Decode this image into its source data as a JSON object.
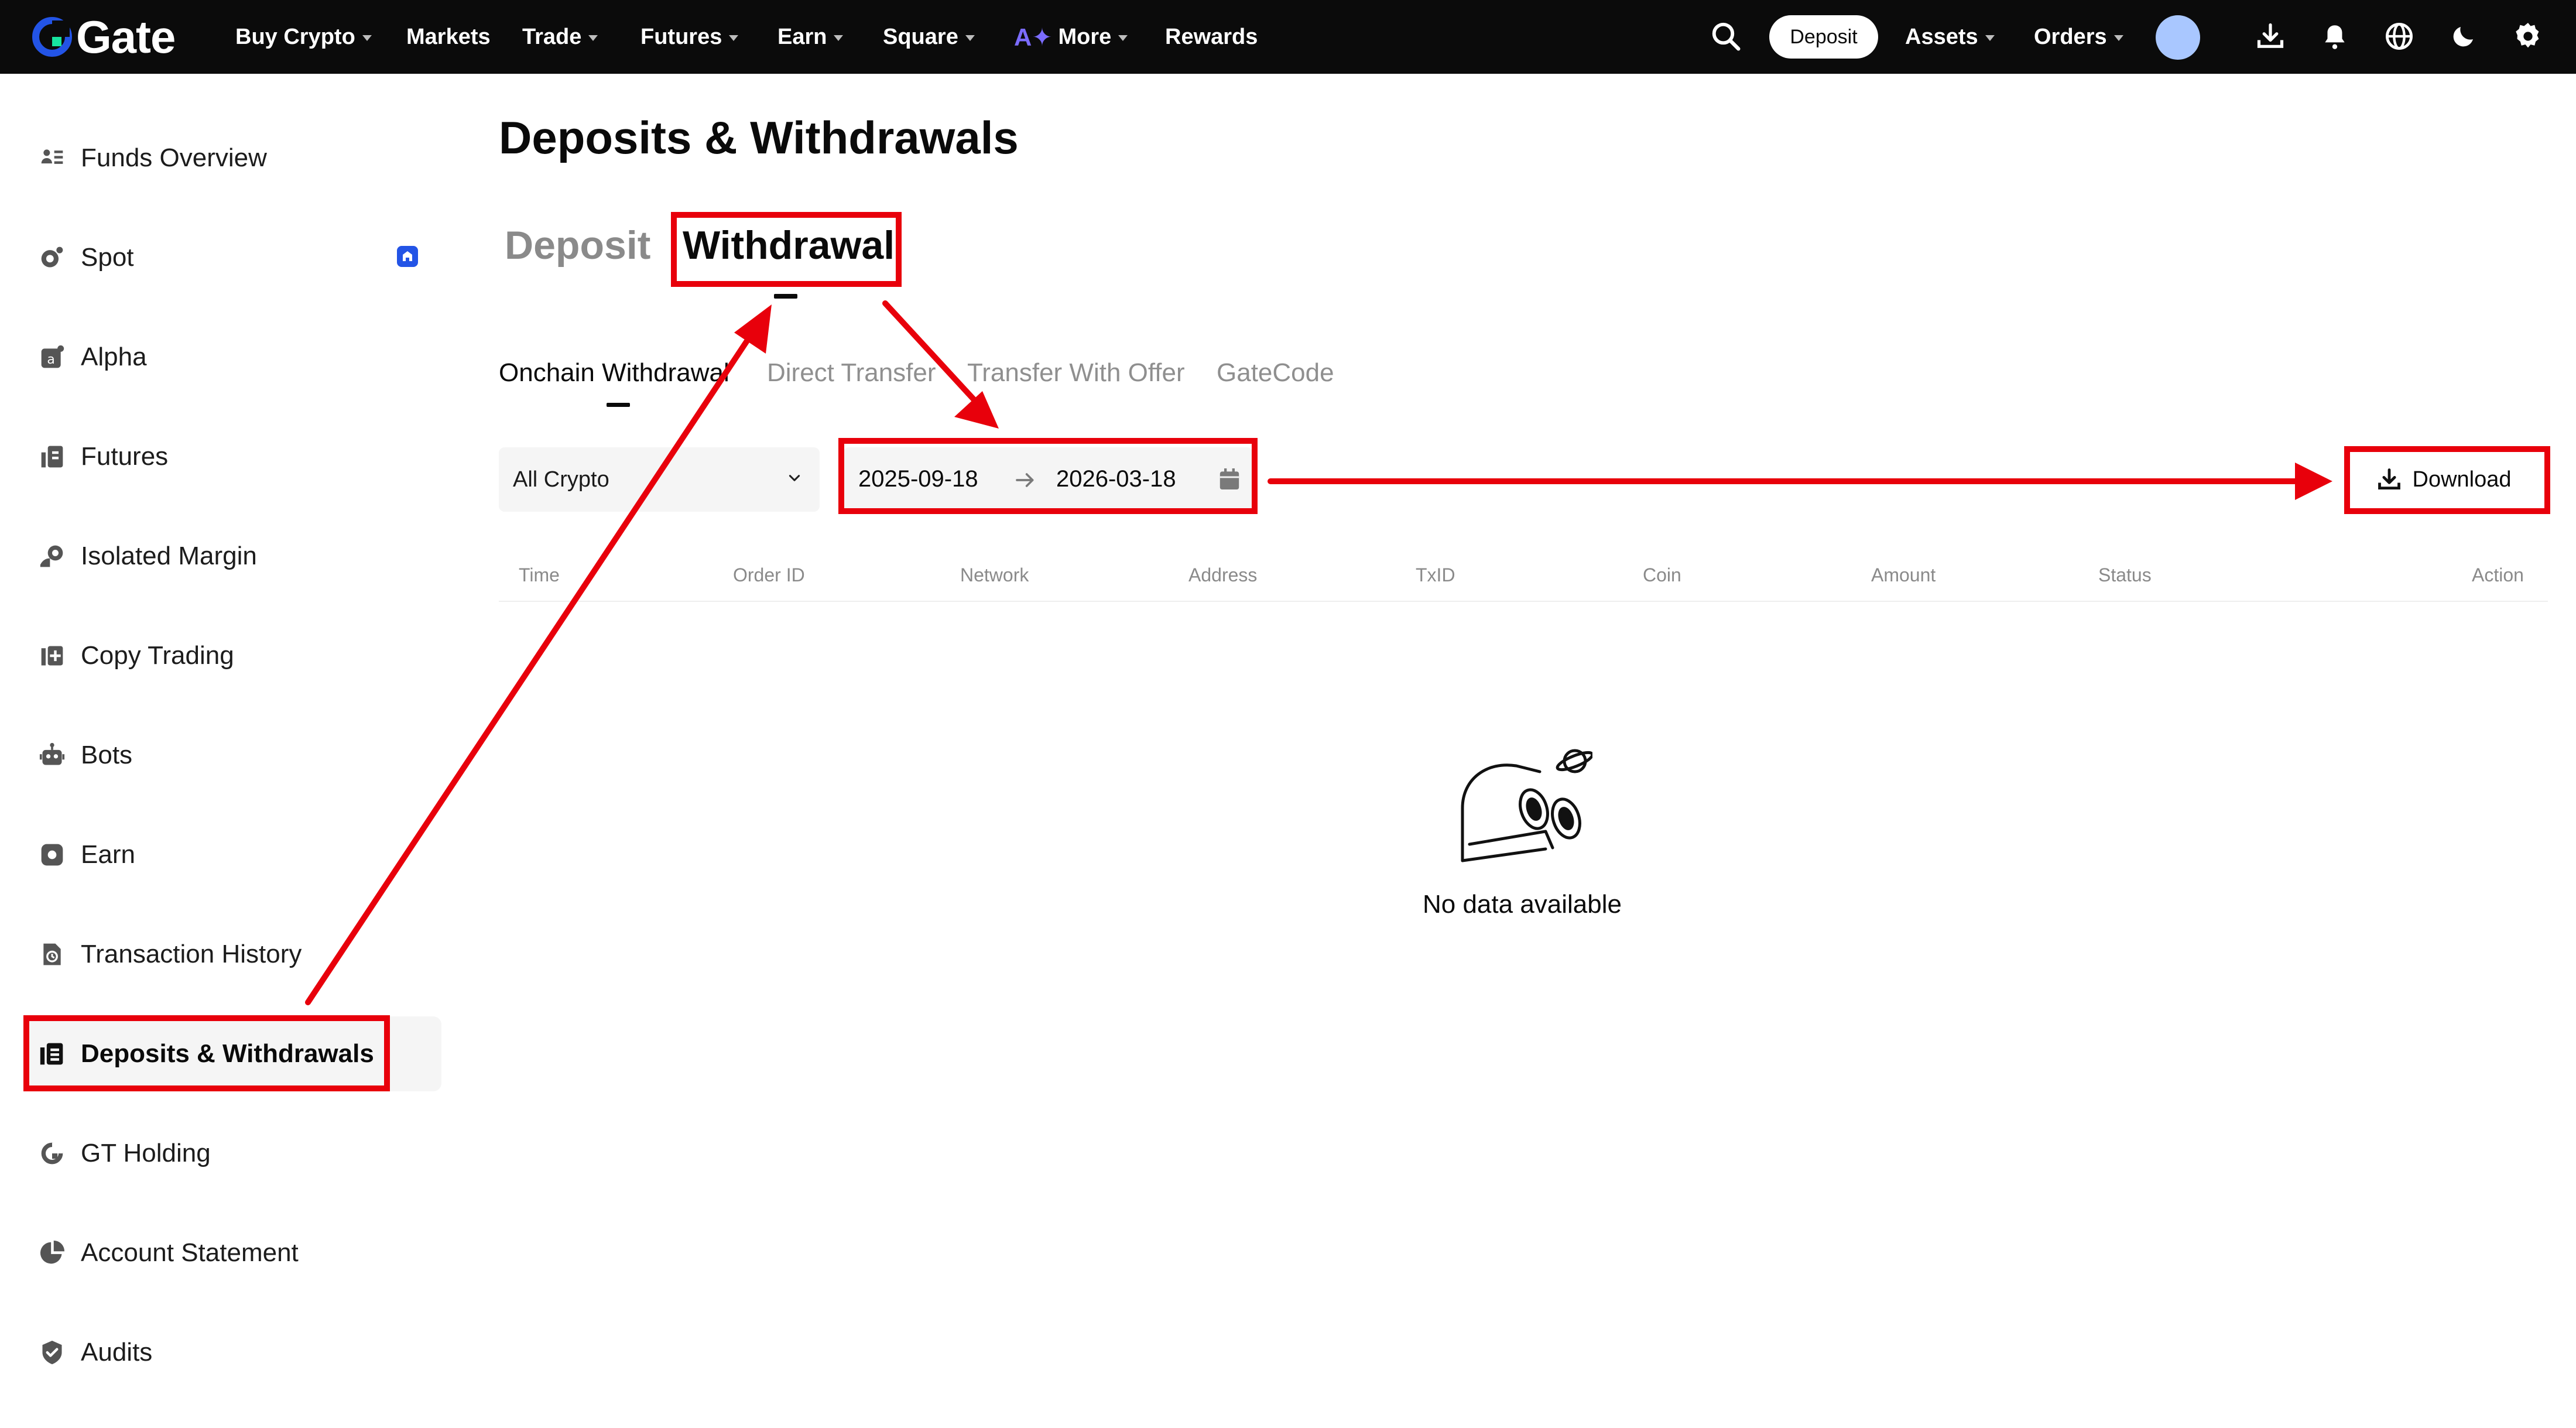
{
  "topnav": {
    "logo": "Gate",
    "items": [
      {
        "label": "Buy Crypto",
        "dropdown": true
      },
      {
        "label": "Markets",
        "dropdown": false
      },
      {
        "label": "Trade",
        "dropdown": true
      },
      {
        "label": "Futures",
        "dropdown": true
      },
      {
        "label": "Earn",
        "dropdown": true
      },
      {
        "label": "Square",
        "dropdown": true
      },
      {
        "label": "More",
        "dropdown": true
      },
      {
        "label": "Rewards",
        "dropdown": false
      }
    ],
    "deposit_label": "Deposit",
    "assets_label": "Assets",
    "orders_label": "Orders",
    "icons": [
      "search-icon",
      "download-app-icon",
      "bell-icon",
      "globe-icon",
      "moon-icon",
      "gear-icon"
    ]
  },
  "sidebar": {
    "items": [
      {
        "label": "Funds Overview",
        "icon": "funds-icon"
      },
      {
        "label": "Spot",
        "icon": "spot-icon",
        "badge": true
      },
      {
        "label": "Alpha",
        "icon": "alpha-icon"
      },
      {
        "label": "Futures",
        "icon": "futures-icon"
      },
      {
        "label": "Isolated Margin",
        "icon": "margin-icon"
      },
      {
        "label": "Copy Trading",
        "icon": "copy-trading-icon"
      },
      {
        "label": "Bots",
        "icon": "bot-icon"
      },
      {
        "label": "Earn",
        "icon": "earn-icon"
      },
      {
        "label": "Transaction History",
        "icon": "history-icon"
      },
      {
        "label": "Deposits & Withdrawals",
        "icon": "deposits-icon",
        "active": true
      },
      {
        "label": "GT Holding",
        "icon": "gt-icon"
      },
      {
        "label": "Account Statement",
        "icon": "statement-icon"
      },
      {
        "label": "Audits",
        "icon": "shield-icon"
      }
    ]
  },
  "main": {
    "title": "Deposits & Withdrawals",
    "tabs": [
      {
        "label": "Deposit",
        "active": false
      },
      {
        "label": "Withdrawal",
        "active": true
      }
    ],
    "subtabs": [
      {
        "label": "Onchain Withdrawal",
        "active": true
      },
      {
        "label": "Direct Transfer",
        "active": false
      },
      {
        "label": "Transfer With Offer",
        "active": false
      },
      {
        "label": "GateCode",
        "active": false
      }
    ],
    "filter": {
      "crypto_value": "All Crypto",
      "date_start": "2025-09-18",
      "date_end": "2026-03-18"
    },
    "download_label": "Download",
    "columns": [
      "Time",
      "Order ID",
      "Network",
      "Address",
      "TxID",
      "Coin",
      "Amount",
      "Status",
      "Action"
    ],
    "empty_text": "No data available"
  },
  "colors": {
    "nav_bg": "#0b0b0b",
    "annotation_red": "#e8000b",
    "brand_blue": "#2354e6",
    "ai_purple": "#7b6cff"
  }
}
